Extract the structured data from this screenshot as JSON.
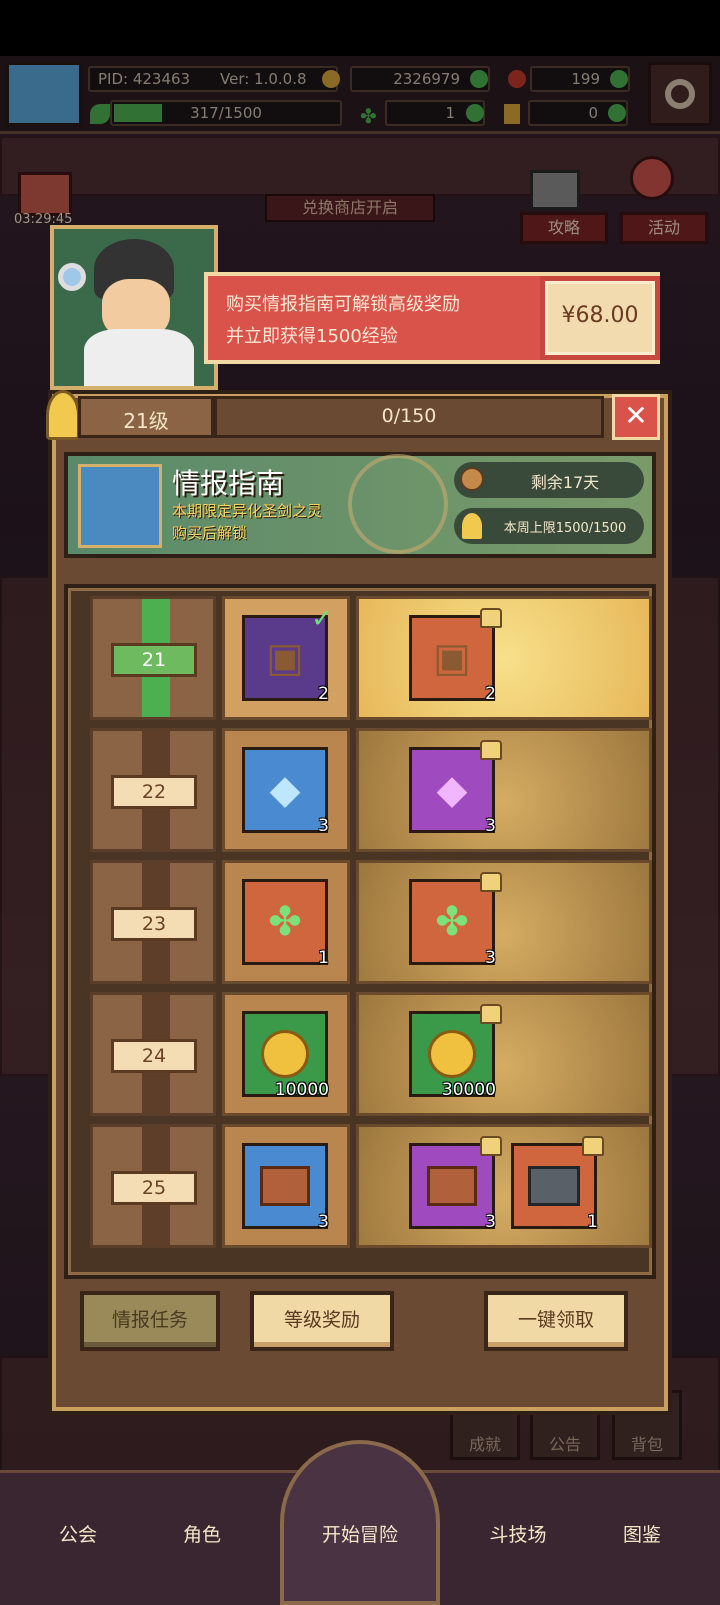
{
  "hud": {
    "pid": "PID: 423463",
    "ver": "Ver: 1.0.0.8",
    "gold": "2326979",
    "gems": "199",
    "exp": "317/1500",
    "clover": "1",
    "keys": "0"
  },
  "scene": {
    "timer": "03:29:45",
    "shop_banner": "兑换商店开启",
    "strategy": "攻略",
    "event": "活动",
    "achievement": "成就",
    "notice": "公告",
    "bag": "背包"
  },
  "promo": {
    "line1": "购买情报指南可解锁高级奖励",
    "line2": "并立即获得1500经验",
    "price": "¥68.00"
  },
  "level_bar": {
    "level": "21级",
    "progress_text": "0/150",
    "progress": 0
  },
  "guide": {
    "title": "情报指南",
    "subtitle1": "本期限定异化圣剑之灵",
    "subtitle2": "购买后解锁",
    "remaining": "剩余17天",
    "weekly_limit": "本周上限1500/1500"
  },
  "rows": [
    {
      "level": "21",
      "free": {
        "icon": "chest-icon",
        "qty": "2",
        "claimed": true
      },
      "premium": [
        {
          "icon": "chest-icon",
          "qty": "2"
        }
      ]
    },
    {
      "level": "22",
      "free": {
        "icon": "blue-crystal-icon",
        "qty": "3"
      },
      "premium": [
        {
          "icon": "purple-crystal-icon",
          "qty": "3"
        }
      ]
    },
    {
      "level": "23",
      "free": {
        "icon": "clover-icon",
        "qty": "1"
      },
      "premium": [
        {
          "icon": "clover-icon",
          "qty": "3"
        }
      ]
    },
    {
      "level": "24",
      "free": {
        "icon": "gold-coin-icon",
        "qty": "10000"
      },
      "premium": [
        {
          "icon": "gold-coin-icon",
          "qty": "30000"
        }
      ]
    },
    {
      "level": "25",
      "free": {
        "icon": "crate-icon",
        "qty": "3"
      },
      "premium": [
        {
          "icon": "crate-icon",
          "qty": "3"
        },
        {
          "icon": "iron-chest-icon",
          "qty": "1"
        }
      ]
    }
  ],
  "buttons": {
    "tasks": "情报任务",
    "level_rewards": "等级奖励",
    "claim_all": "一键领取"
  },
  "bottom_nav": [
    "公会",
    "角色",
    "开始冒险",
    "斗技场",
    "图鉴"
  ],
  "colors": {
    "promo_red": "#d9534a",
    "accent_gold": "#caa05e",
    "bar_green": "#4caf50"
  }
}
